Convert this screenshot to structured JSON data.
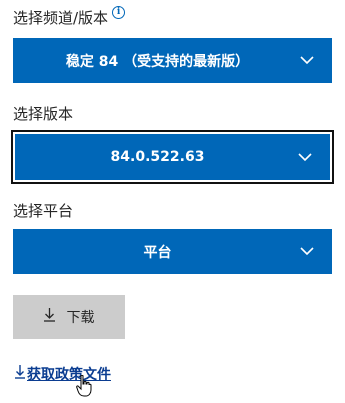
{
  "channel": {
    "label": "选择频道/版本",
    "info_icon": "info-icon",
    "selected": "稳定 84 （受支持的最新版）"
  },
  "version": {
    "label": "选择版本",
    "selected": "84.0.522.63"
  },
  "platform": {
    "label": "选择平台",
    "selected": "平台"
  },
  "download": {
    "label": "下载",
    "icon": "download-icon"
  },
  "policy": {
    "label": "获取政策文件",
    "icon": "download-icon"
  },
  "colors": {
    "accent": "#0067b8",
    "button_gray": "#cccccc",
    "link": "#0b3d91"
  }
}
